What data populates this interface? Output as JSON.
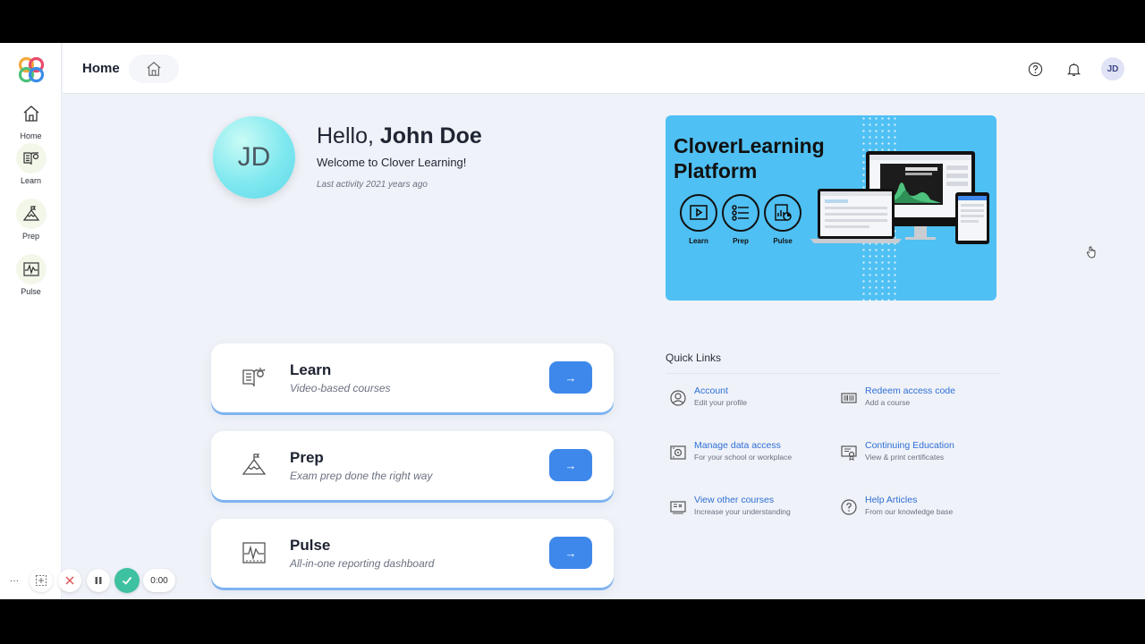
{
  "header": {
    "title": "Home"
  },
  "sidebar": {
    "items": [
      {
        "label": "Home",
        "icon": "home-icon"
      },
      {
        "label": "Learn",
        "icon": "book-icon"
      },
      {
        "label": "Prep",
        "icon": "summit-icon"
      },
      {
        "label": "Pulse",
        "icon": "pulse-chart-icon"
      }
    ]
  },
  "user": {
    "initials": "JD",
    "greeting": "Hello, ",
    "name": "John Doe",
    "welcome": "Welcome to Clover Learning!",
    "last_activity": "Last activity 2021 years ago"
  },
  "banner": {
    "title": "CloverLearning Platform",
    "icons": [
      {
        "label": "Learn"
      },
      {
        "label": "Prep"
      },
      {
        "label": "Pulse"
      }
    ]
  },
  "cards": [
    {
      "title": "Learn",
      "subtitle": "Video-based courses",
      "go": "→"
    },
    {
      "title": "Prep",
      "subtitle": "Exam prep done the right way",
      "go": "→"
    },
    {
      "title": "Pulse",
      "subtitle": "All-in-one reporting dashboard",
      "go": "→"
    }
  ],
  "quick_links": {
    "title": "Quick Links",
    "items": [
      {
        "label": "Account",
        "sub": "Edit your profile",
        "icon": "user-circle-icon"
      },
      {
        "label": "Redeem access code",
        "sub": "Add a course",
        "icon": "barcode-icon"
      },
      {
        "label": "Manage data access",
        "sub": "For your school or workplace",
        "icon": "data-access-icon"
      },
      {
        "label": "Continuing Education",
        "sub": "View & print certificates",
        "icon": "certificate-icon"
      },
      {
        "label": "View other courses",
        "sub": "Increase your understanding",
        "icon": "courses-icon"
      },
      {
        "label": "Help Articles",
        "sub": "From our knowledge base",
        "icon": "question-circle-icon"
      }
    ]
  },
  "recorder": {
    "more": "···",
    "timer": "0:00"
  },
  "colors": {
    "accent": "#3e88ec",
    "banner": "#4fc0f3",
    "link": "#2f6fd6",
    "background": "#eff2f8"
  }
}
